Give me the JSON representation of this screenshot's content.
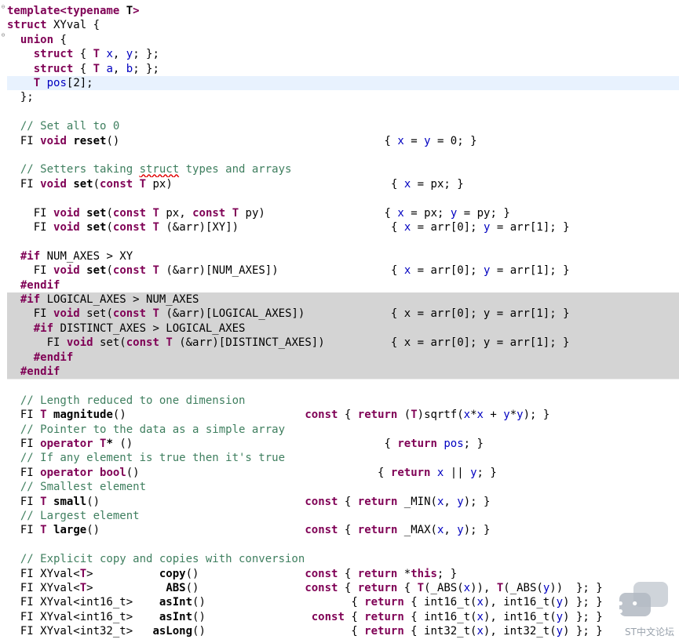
{
  "editor": {
    "watermark": {
      "text": "ST中文论坛",
      "icon": "chat-bubbles-icon"
    },
    "colors": {
      "keyword": "#7f0055",
      "field": "#0000c0",
      "comment": "#3f7f5f",
      "current_line": "#e8f2fe",
      "inactive_block": "#d4d4d4"
    },
    "lines": [
      [
        [
          "kw",
          "template<typename "
        ],
        [
          "bold",
          "T"
        ],
        [
          "kw",
          ">"
        ]
      ],
      [
        [
          "kw",
          "struct"
        ],
        [
          "plain",
          " XYval {"
        ]
      ],
      [
        [
          "plain",
          "  "
        ],
        [
          "kw",
          "union"
        ],
        [
          "plain",
          " {"
        ]
      ],
      [
        [
          "plain",
          "    "
        ],
        [
          "kw",
          "struct"
        ],
        [
          "plain",
          " { "
        ],
        [
          "kw",
          "T"
        ],
        [
          "plain",
          " "
        ],
        [
          "param",
          "x"
        ],
        [
          "plain",
          ", "
        ],
        [
          "param",
          "y"
        ],
        [
          "plain",
          "; };"
        ]
      ],
      [
        [
          "plain",
          "    "
        ],
        [
          "kw",
          "struct"
        ],
        [
          "plain",
          " { "
        ],
        [
          "kw",
          "T"
        ],
        [
          "plain",
          " "
        ],
        [
          "param",
          "a"
        ],
        [
          "plain",
          ", "
        ],
        [
          "param",
          "b"
        ],
        [
          "plain",
          "; };"
        ]
      ],
      [
        [
          "plain",
          "    "
        ],
        [
          "kw",
          "T"
        ],
        [
          "plain",
          " "
        ],
        [
          "param",
          "pos"
        ],
        [
          "plain",
          "[2];"
        ]
      ],
      [
        [
          "plain",
          "  };"
        ]
      ],
      [
        [
          "plain",
          ""
        ]
      ],
      [
        [
          "plain",
          "  "
        ],
        [
          "comment",
          "// Set all to 0"
        ]
      ],
      [
        [
          "plain",
          "  FI "
        ],
        [
          "kw",
          "void"
        ],
        [
          "plain",
          " "
        ],
        [
          "bold",
          "reset"
        ],
        [
          "plain",
          "()                                        { "
        ],
        [
          "param",
          "x"
        ],
        [
          "plain",
          " = "
        ],
        [
          "param",
          "y"
        ],
        [
          "plain",
          " = 0; }"
        ]
      ],
      [
        [
          "plain",
          ""
        ]
      ],
      [
        [
          "plain",
          "  "
        ],
        [
          "comment",
          "// Setters taking "
        ],
        [
          "comment squiggle",
          "struct"
        ],
        [
          "comment",
          " types and arrays"
        ]
      ],
      [
        [
          "plain",
          "  FI "
        ],
        [
          "kw",
          "void"
        ],
        [
          "plain",
          " "
        ],
        [
          "bold",
          "set"
        ],
        [
          "plain",
          "("
        ],
        [
          "kw",
          "const"
        ],
        [
          "plain",
          " "
        ],
        [
          "kw",
          "T"
        ],
        [
          "plain",
          " px)                                 { "
        ],
        [
          "param",
          "x"
        ],
        [
          "plain",
          " = px; }"
        ]
      ],
      [
        [
          "plain",
          ""
        ]
      ],
      [
        [
          "plain",
          "    FI "
        ],
        [
          "kw",
          "void"
        ],
        [
          "plain",
          " "
        ],
        [
          "bold",
          "set"
        ],
        [
          "plain",
          "("
        ],
        [
          "kw",
          "const"
        ],
        [
          "plain",
          " "
        ],
        [
          "kw",
          "T"
        ],
        [
          "plain",
          " px, "
        ],
        [
          "kw",
          "const"
        ],
        [
          "plain",
          " "
        ],
        [
          "kw",
          "T"
        ],
        [
          "plain",
          " py)                  { "
        ],
        [
          "param",
          "x"
        ],
        [
          "plain",
          " = px; "
        ],
        [
          "param",
          "y"
        ],
        [
          "plain",
          " = py; }"
        ]
      ],
      [
        [
          "plain",
          "    FI "
        ],
        [
          "kw",
          "void"
        ],
        [
          "plain",
          " "
        ],
        [
          "bold",
          "set"
        ],
        [
          "plain",
          "("
        ],
        [
          "kw",
          "const"
        ],
        [
          "plain",
          " "
        ],
        [
          "kw",
          "T"
        ],
        [
          "plain",
          " (&arr)[XY])                       { "
        ],
        [
          "param",
          "x"
        ],
        [
          "plain",
          " = arr[0]; "
        ],
        [
          "param",
          "y"
        ],
        [
          "plain",
          " = arr[1]; }"
        ]
      ],
      [
        [
          "plain",
          ""
        ]
      ],
      [
        [
          "plain",
          "  "
        ],
        [
          "kw",
          "#if"
        ],
        [
          "plain",
          " NUM_AXES > XY"
        ]
      ],
      [
        [
          "plain",
          "    FI "
        ],
        [
          "kw",
          "void"
        ],
        [
          "plain",
          " "
        ],
        [
          "bold",
          "set"
        ],
        [
          "plain",
          "("
        ],
        [
          "kw",
          "const"
        ],
        [
          "plain",
          " "
        ],
        [
          "kw",
          "T"
        ],
        [
          "plain",
          " (&arr)[NUM_AXES])                 { "
        ],
        [
          "param",
          "x"
        ],
        [
          "plain",
          " = arr[0]; "
        ],
        [
          "param",
          "y"
        ],
        [
          "plain",
          " = arr[1]; }"
        ]
      ],
      [
        [
          "plain",
          "  "
        ],
        [
          "kw",
          "#endif"
        ]
      ],
      [
        [
          "plain",
          "  "
        ],
        [
          "kw",
          "#if"
        ],
        [
          "plain",
          " LOGICAL_AXES > NUM_AXES"
        ]
      ],
      [
        [
          "plain",
          "    FI "
        ],
        [
          "kw",
          "void"
        ],
        [
          "plain",
          " set("
        ],
        [
          "kw",
          "const"
        ],
        [
          "plain",
          " "
        ],
        [
          "kw",
          "T"
        ],
        [
          "plain",
          " (&arr)[LOGICAL_AXES])             { x = arr[0]; y = arr[1]; }"
        ]
      ],
      [
        [
          "plain",
          "    "
        ],
        [
          "kw",
          "#if"
        ],
        [
          "plain",
          " DISTINCT_AXES > LOGICAL_AXES"
        ]
      ],
      [
        [
          "plain",
          "      FI "
        ],
        [
          "kw",
          "void"
        ],
        [
          "plain",
          " set("
        ],
        [
          "kw",
          "const"
        ],
        [
          "plain",
          " "
        ],
        [
          "kw",
          "T"
        ],
        [
          "plain",
          " (&arr)[DISTINCT_AXES])          { x = arr[0]; y = arr[1]; }"
        ]
      ],
      [
        [
          "plain",
          "    "
        ],
        [
          "kw",
          "#endif"
        ]
      ],
      [
        [
          "plain",
          "  "
        ],
        [
          "kw",
          "#endif"
        ]
      ],
      [
        [
          "plain",
          ""
        ]
      ],
      [
        [
          "plain",
          "  "
        ],
        [
          "comment",
          "// Length reduced to one dimension"
        ]
      ],
      [
        [
          "plain",
          "  FI "
        ],
        [
          "kw",
          "T"
        ],
        [
          "plain",
          " "
        ],
        [
          "bold",
          "magnitude"
        ],
        [
          "plain",
          "()                           "
        ],
        [
          "kw",
          "const"
        ],
        [
          "plain",
          " { "
        ],
        [
          "kw",
          "return"
        ],
        [
          "plain",
          " ("
        ],
        [
          "kw",
          "T"
        ],
        [
          "plain",
          ")sqrtf("
        ],
        [
          "param",
          "x"
        ],
        [
          "plain",
          "*"
        ],
        [
          "param",
          "x"
        ],
        [
          "plain",
          " + "
        ],
        [
          "param",
          "y"
        ],
        [
          "plain",
          "*"
        ],
        [
          "param",
          "y"
        ],
        [
          "plain",
          "); }"
        ]
      ],
      [
        [
          "plain",
          "  "
        ],
        [
          "comment",
          "// Pointer to the data as a simple array"
        ]
      ],
      [
        [
          "plain",
          "  FI "
        ],
        [
          "kw",
          "operator"
        ],
        [
          "plain",
          " "
        ],
        [
          "kw",
          "T"
        ],
        [
          "bold",
          "*"
        ],
        [
          "plain",
          " ()                                      { "
        ],
        [
          "kw",
          "return"
        ],
        [
          "plain",
          " "
        ],
        [
          "param",
          "pos"
        ],
        [
          "plain",
          "; }"
        ]
      ],
      [
        [
          "plain",
          "  "
        ],
        [
          "comment",
          "// If any element is true then it's true"
        ]
      ],
      [
        [
          "plain",
          "  FI "
        ],
        [
          "kw",
          "operator"
        ],
        [
          "plain",
          " "
        ],
        [
          "kw",
          "bool"
        ],
        [
          "plain",
          "()                                    { "
        ],
        [
          "kw",
          "return"
        ],
        [
          "plain",
          " "
        ],
        [
          "param",
          "x"
        ],
        [
          "plain",
          " || "
        ],
        [
          "param",
          "y"
        ],
        [
          "plain",
          "; }"
        ]
      ],
      [
        [
          "plain",
          "  "
        ],
        [
          "comment",
          "// Smallest element"
        ]
      ],
      [
        [
          "plain",
          "  FI "
        ],
        [
          "kw",
          "T"
        ],
        [
          "plain",
          " "
        ],
        [
          "bold",
          "small"
        ],
        [
          "plain",
          "()                               "
        ],
        [
          "kw",
          "const"
        ],
        [
          "plain",
          " { "
        ],
        [
          "kw",
          "return"
        ],
        [
          "plain",
          " _MIN("
        ],
        [
          "param",
          "x"
        ],
        [
          "plain",
          ", "
        ],
        [
          "param",
          "y"
        ],
        [
          "plain",
          "); }"
        ]
      ],
      [
        [
          "plain",
          "  "
        ],
        [
          "comment",
          "// Largest element"
        ]
      ],
      [
        [
          "plain",
          "  FI "
        ],
        [
          "kw",
          "T"
        ],
        [
          "plain",
          " "
        ],
        [
          "bold",
          "large"
        ],
        [
          "plain",
          "()                               "
        ],
        [
          "kw",
          "const"
        ],
        [
          "plain",
          " { "
        ],
        [
          "kw",
          "return"
        ],
        [
          "plain",
          " _MAX("
        ],
        [
          "param",
          "x"
        ],
        [
          "plain",
          ", "
        ],
        [
          "param",
          "y"
        ],
        [
          "plain",
          "); }"
        ]
      ],
      [
        [
          "plain",
          ""
        ]
      ],
      [
        [
          "plain",
          "  "
        ],
        [
          "comment",
          "// Explicit copy and copies with conversion"
        ]
      ],
      [
        [
          "plain",
          "  FI XYval<"
        ],
        [
          "kw",
          "T"
        ],
        [
          "plain",
          ">          "
        ],
        [
          "bold",
          "copy"
        ],
        [
          "plain",
          "()                "
        ],
        [
          "kw",
          "const"
        ],
        [
          "plain",
          " { "
        ],
        [
          "kw",
          "return"
        ],
        [
          "plain",
          " *"
        ],
        [
          "kw",
          "this"
        ],
        [
          "plain",
          "; }"
        ]
      ],
      [
        [
          "plain",
          "  FI XYval<"
        ],
        [
          "kw",
          "T"
        ],
        [
          "plain",
          ">           "
        ],
        [
          "bold",
          "ABS"
        ],
        [
          "plain",
          "()                "
        ],
        [
          "kw",
          "const"
        ],
        [
          "plain",
          " { "
        ],
        [
          "kw",
          "return"
        ],
        [
          "plain",
          " { "
        ],
        [
          "kw",
          "T"
        ],
        [
          "plain",
          "(_ABS("
        ],
        [
          "param",
          "x"
        ],
        [
          "plain",
          ")), "
        ],
        [
          "kw",
          "T"
        ],
        [
          "plain",
          "(_ABS("
        ],
        [
          "param",
          "y"
        ],
        [
          "plain",
          "))  }; }"
        ]
      ],
      [
        [
          "plain",
          "  FI XYval<int16_t>    "
        ],
        [
          "bold",
          "asInt"
        ],
        [
          "plain",
          "()                      { "
        ],
        [
          "kw",
          "return"
        ],
        [
          "plain",
          " { int16_t("
        ],
        [
          "param",
          "x"
        ],
        [
          "plain",
          "), int16_t("
        ],
        [
          "param",
          "y"
        ],
        [
          "plain",
          ") }; }"
        ]
      ],
      [
        [
          "plain",
          "  FI XYval<int16_t>    "
        ],
        [
          "bold",
          "asInt"
        ],
        [
          "plain",
          "()                "
        ],
        [
          "kw",
          "const"
        ],
        [
          "plain",
          " { "
        ],
        [
          "kw",
          "return"
        ],
        [
          "plain",
          " { int16_t("
        ],
        [
          "param",
          "x"
        ],
        [
          "plain",
          "), int16_t("
        ],
        [
          "param",
          "y"
        ],
        [
          "plain",
          ") }; }"
        ]
      ],
      [
        [
          "plain",
          "  FI XYval<int32_t>   "
        ],
        [
          "bold",
          "asLong"
        ],
        [
          "plain",
          "()                      { "
        ],
        [
          "kw",
          "return"
        ],
        [
          "plain",
          " { int32_t("
        ],
        [
          "param",
          "x"
        ],
        [
          "plain",
          "), int32_t("
        ],
        [
          "param",
          "y"
        ],
        [
          "plain",
          ") }; }"
        ]
      ]
    ]
  }
}
